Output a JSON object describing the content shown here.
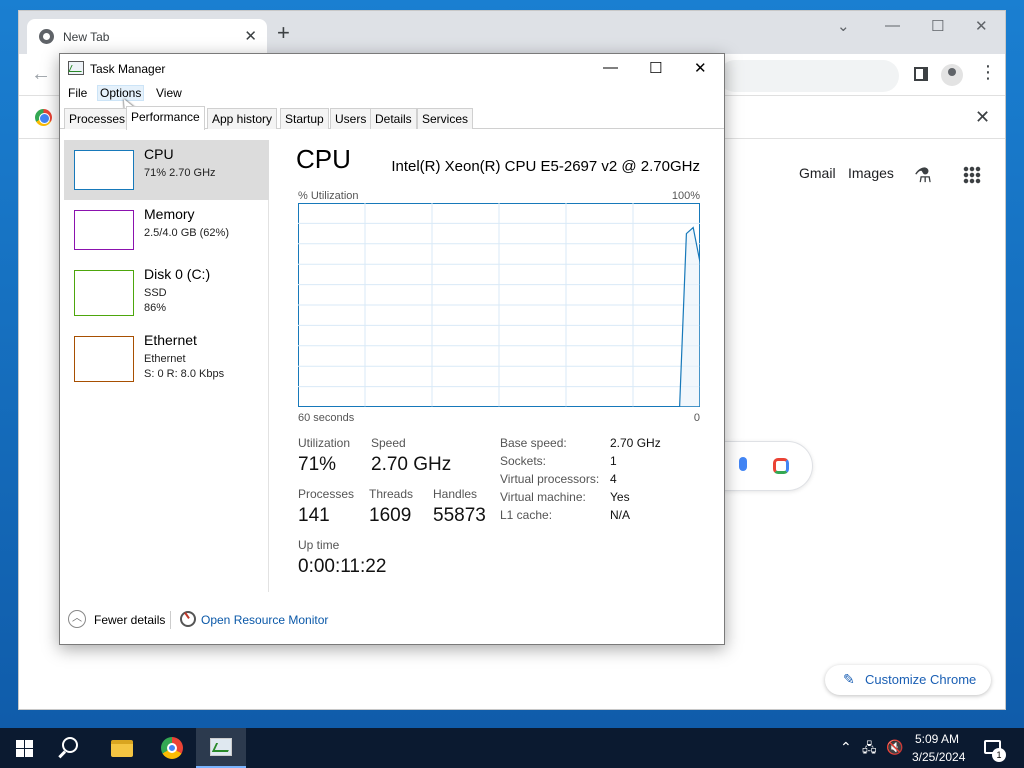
{
  "chrome": {
    "tab_title": "New Tab",
    "ntp_links": [
      "Gmail",
      "Images"
    ],
    "customize_label": "Customize Chrome"
  },
  "task_manager": {
    "title": "Task Manager",
    "menus": [
      "File",
      "Options",
      "View"
    ],
    "tabs": [
      "Processes",
      "Performance",
      "App history",
      "Startup",
      "Users",
      "Details",
      "Services"
    ],
    "active_tab": "Performance",
    "resources": [
      {
        "name": "CPU",
        "lines": [
          "71% 2.70 GHz"
        ],
        "color": "#1779ba"
      },
      {
        "name": "Memory",
        "lines": [
          "2.5/4.0 GB (62%)"
        ],
        "color": "#8b12ae"
      },
      {
        "name": "Disk 0 (C:)",
        "lines": [
          "SSD",
          "86%"
        ],
        "color": "#4da60c"
      },
      {
        "name": "Ethernet",
        "lines": [
          "Ethernet",
          "S: 0 R: 8.0 Kbps"
        ],
        "color": "#a74f01"
      }
    ],
    "cpu": {
      "heading": "CPU",
      "model": "Intel(R) Xeon(R) CPU E5-2697 v2 @ 2.70GHz",
      "graph_y_label": "% Utilization",
      "graph_y_max": "100%",
      "graph_x_label": "60 seconds",
      "graph_x_min": "0",
      "graph_color": "#1779ba",
      "utilization_series": [
        0,
        0,
        0,
        0,
        0,
        0,
        0,
        0,
        0,
        0,
        0,
        0,
        0,
        0,
        0,
        0,
        0,
        0,
        0,
        0,
        0,
        0,
        0,
        0,
        0,
        0,
        0,
        0,
        0,
        0,
        0,
        0,
        0,
        0,
        0,
        0,
        0,
        0,
        0,
        0,
        0,
        0,
        0,
        0,
        0,
        0,
        0,
        0,
        0,
        0,
        0,
        0,
        0,
        0,
        0,
        0,
        0,
        85,
        88,
        71
      ],
      "stats": {
        "utilization_label": "Utilization",
        "utilization_value": "71%",
        "speed_label": "Speed",
        "speed_value": "2.70 GHz",
        "processes_label": "Processes",
        "processes_value": "141",
        "threads_label": "Threads",
        "threads_value": "1609",
        "handles_label": "Handles",
        "handles_value": "55873",
        "uptime_label": "Up time",
        "uptime_value": "0:00:11:22"
      },
      "details": [
        {
          "key": "Base speed:",
          "value": "2.70 GHz"
        },
        {
          "key": "Sockets:",
          "value": "1"
        },
        {
          "key": "Virtual processors:",
          "value": "4"
        },
        {
          "key": "Virtual machine:",
          "value": "Yes"
        },
        {
          "key": "L1 cache:",
          "value": "N/A"
        }
      ]
    },
    "footer": {
      "fewer_details": "Fewer details",
      "resource_monitor": "Open Resource Monitor"
    }
  },
  "taskbar": {
    "time": "5:09 AM",
    "date": "3/25/2024",
    "notification_count": "1"
  }
}
